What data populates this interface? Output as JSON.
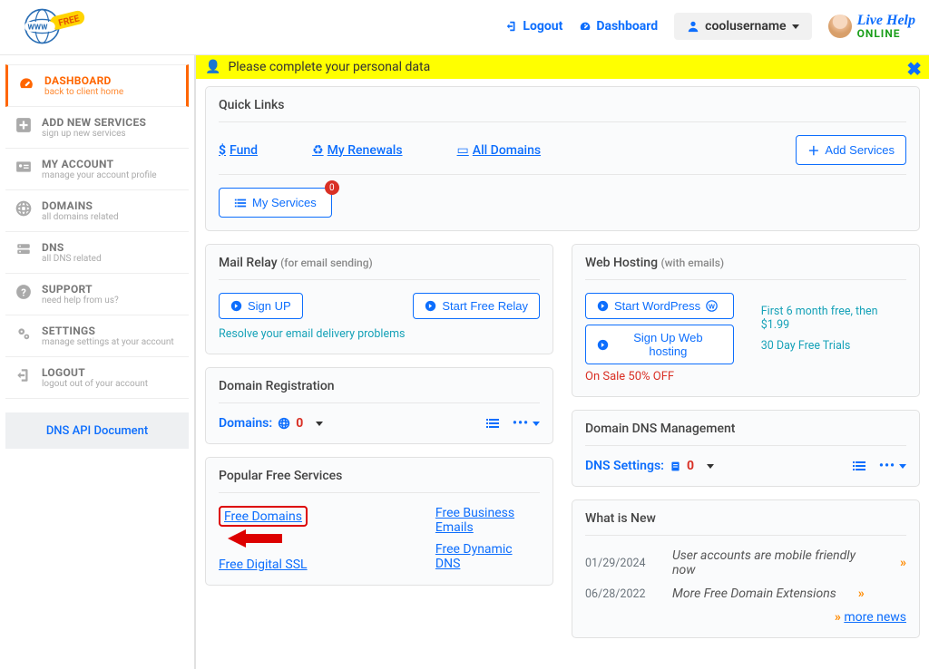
{
  "header": {
    "logout": "Logout",
    "dashboard": "Dashboard",
    "username": "coolusername",
    "live_help_big": "Live Help",
    "live_help_small": "ONLINE"
  },
  "sidebar": {
    "items": [
      {
        "title": "DASHBOARD",
        "sub": "back to client home",
        "icon": "gauge"
      },
      {
        "title": "ADD NEW SERVICES",
        "sub": "sign up new services",
        "icon": "plus"
      },
      {
        "title": "MY ACCOUNT",
        "sub": "manage your account profile",
        "icon": "idcard"
      },
      {
        "title": "DOMAINS",
        "sub": "all domains related",
        "icon": "globe"
      },
      {
        "title": "DNS",
        "sub": "all DNS related",
        "icon": "server"
      },
      {
        "title": "SUPPORT",
        "sub": "need help from us?",
        "icon": "help"
      },
      {
        "title": "SETTINGS",
        "sub": "manage settings at your account",
        "icon": "cogs"
      },
      {
        "title": "LOGOUT",
        "sub": "logout out of your account",
        "icon": "exit"
      }
    ],
    "api_doc": "DNS API Document"
  },
  "alert": {
    "text": "Please complete your personal data"
  },
  "quicklinks": {
    "heading": "Quick Links",
    "fund": "Fund",
    "renewals": "My Renewals",
    "all_domains": "All Domains",
    "add_services": "Add Services",
    "my_services": "My Services",
    "my_services_badge": "0"
  },
  "mail": {
    "heading": "Mail Relay",
    "hint": "(for email sending)",
    "signup": "Sign UP",
    "start": "Start Free Relay",
    "resolve": "Resolve your email delivery problems"
  },
  "hosting": {
    "heading": "Web Hosting",
    "hint": "(with emails)",
    "start_wp": "Start WordPress",
    "signup_hosting": "Sign Up Web hosting",
    "promo1": "First 6 month free, then $1.99",
    "promo2": "30 Day Free Trials",
    "sale": "On Sale 50% OFF"
  },
  "domain_reg": {
    "heading": "Domain Registration",
    "label": "Domains:",
    "count": "0"
  },
  "domain_dns": {
    "heading": "Domain DNS Management",
    "label": "DNS Settings:",
    "count": "0"
  },
  "free_services": {
    "heading": "Popular Free Services",
    "free_domains": "Free Domains",
    "free_ssl": "Free Digital SSL",
    "free_emails": "Free Business Emails",
    "free_dns": "Free Dynamic DNS"
  },
  "news": {
    "heading": "What is New",
    "items": [
      {
        "date": "01/29/2024",
        "title": "User accounts are mobile friendly now"
      },
      {
        "date": "06/28/2022",
        "title": "More Free Domain Extensions"
      }
    ],
    "more": "more news"
  }
}
